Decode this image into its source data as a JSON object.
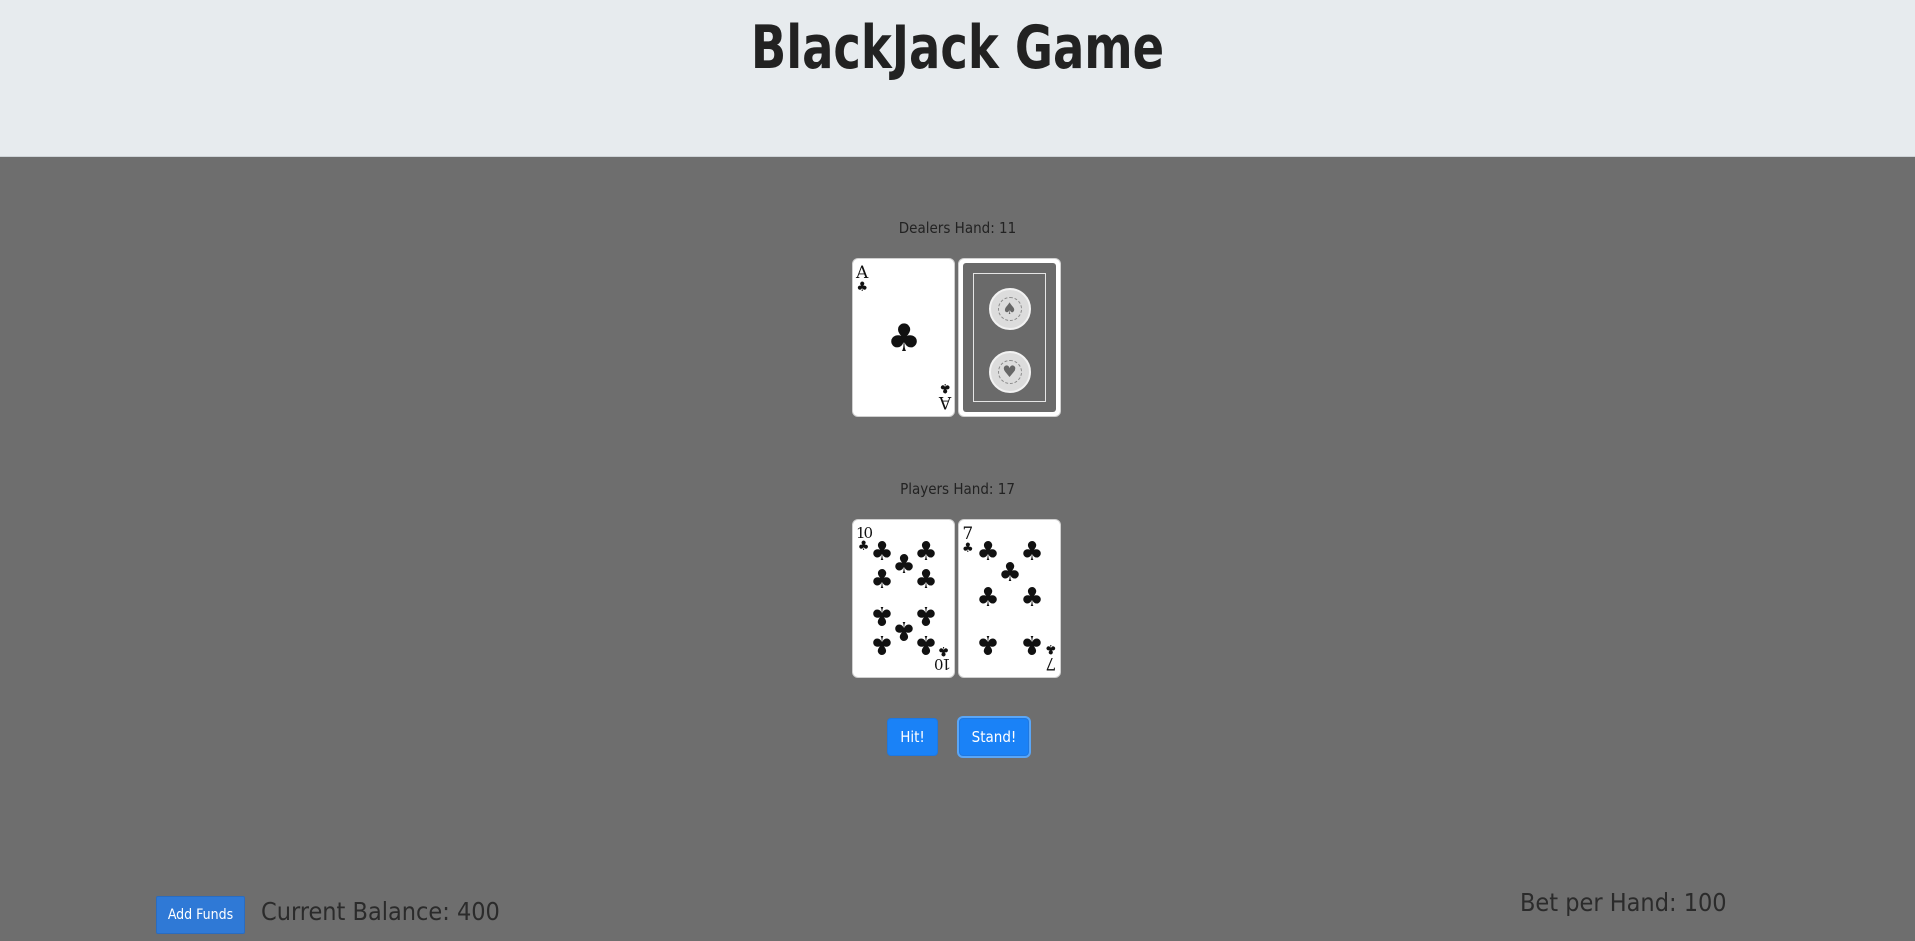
{
  "header": {
    "title": "BlackJack Game"
  },
  "dealer": {
    "label": "Dealers Hand: 11",
    "cards": [
      {
        "rank": "A",
        "suit": "♣",
        "face": "up"
      },
      {
        "face": "down",
        "seal_symbol_top": "♠",
        "seal_symbol_bottom": "♥"
      }
    ]
  },
  "player": {
    "label": "Players Hand: 17",
    "cards": [
      {
        "rank": "10",
        "suit": "♣",
        "face": "up"
      },
      {
        "rank": "7",
        "suit": "♣",
        "face": "up"
      }
    ]
  },
  "actions": {
    "hit_label": "Hit!",
    "stand_label": "Stand!"
  },
  "footer": {
    "add_funds_label": "Add Funds",
    "balance_text": "Current Balance: 400",
    "bet_text": "Bet per Hand: 100"
  },
  "colors": {
    "table": "#6e6e6e",
    "header": "#e7ebee",
    "button": "#1a82f7",
    "add_funds": "#2f79d6"
  },
  "icons": {
    "club": "club-suit-icon",
    "card_back_seal": "card-back-seal-icon"
  }
}
